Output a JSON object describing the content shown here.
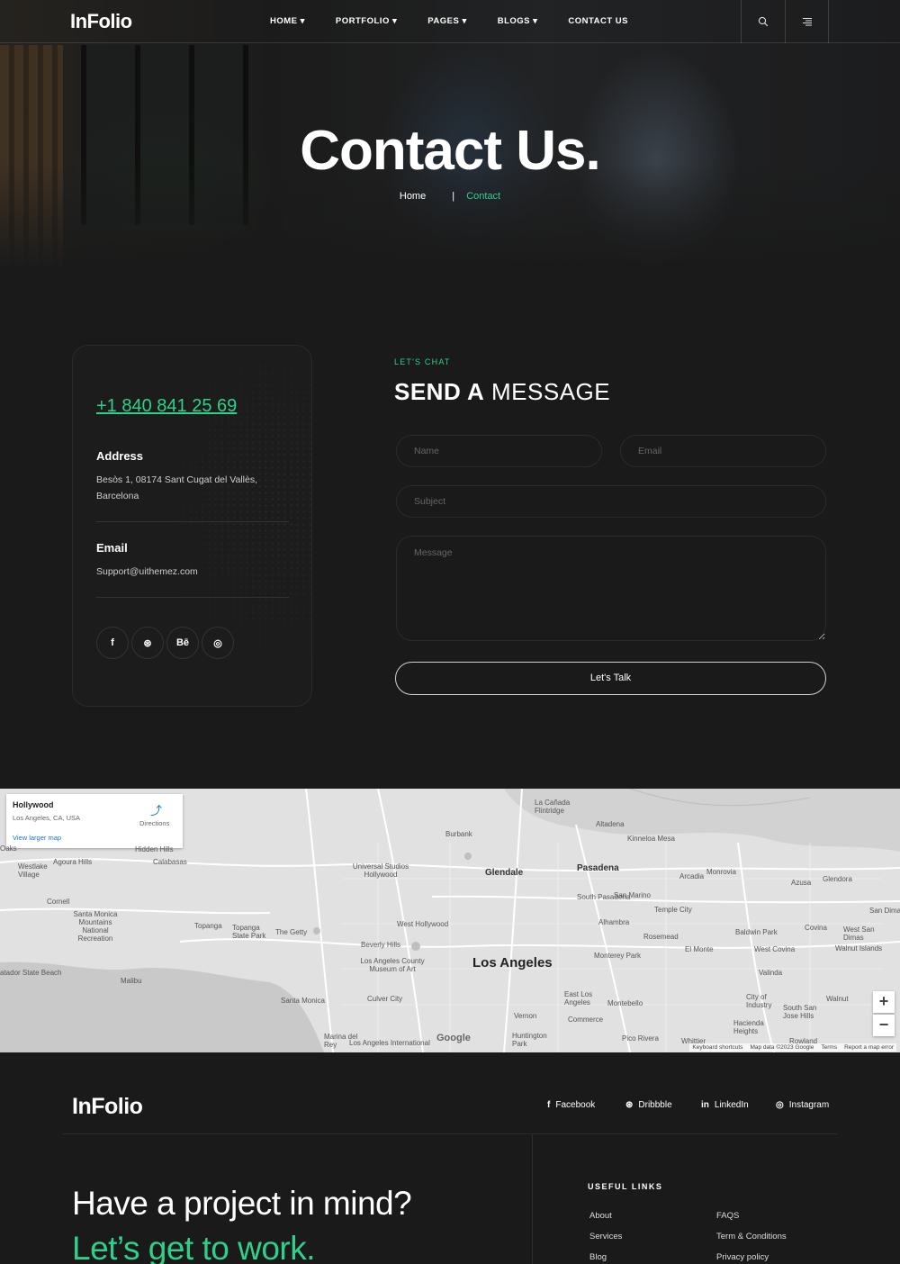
{
  "header": {
    "logo": "InFolio",
    "nav": [
      "HOME ▾",
      "PORTFOLIO ▾",
      "PAGES ▾",
      "BLOGS ▾",
      "CONTACT US"
    ]
  },
  "hero": {
    "title": "Contact Us.",
    "breadcrumb": {
      "home": "Home",
      "separator": "|",
      "current": "Contact"
    }
  },
  "contact": {
    "phone": "+1 840 841 25 69",
    "address_label": "Address",
    "address_line1": "Besòs 1, 08174 Sant Cugat del Vallès,",
    "address_line2": "Barcelona",
    "email_label": "Email",
    "email": "Support@uithemez.com",
    "socials": [
      {
        "icon": "facebook-icon",
        "glyph": "f"
      },
      {
        "icon": "dribbble-icon",
        "glyph": "⊛"
      },
      {
        "icon": "behance-icon",
        "glyph": "Bē"
      },
      {
        "icon": "instagram-icon",
        "glyph": "◎"
      }
    ]
  },
  "form": {
    "eyebrow": "LET'S CHAT",
    "title_bold": "SEND A",
    "title_light": "MESSAGE",
    "name_placeholder": "Name",
    "email_placeholder": "Email",
    "subject_placeholder": "Subject",
    "message_placeholder": "Message",
    "submit_label": "Let's Talk"
  },
  "map": {
    "card_title": "Hollywood",
    "card_subtitle": "Los Angeles, CA, USA",
    "card_link": "View larger map",
    "directions": "Directions",
    "labels": {
      "los_angeles": "Los Angeles",
      "glendale": "Glendale",
      "pasadena": "Pasadena",
      "burbank": "Burbank",
      "santa_monica": "Santa Monica",
      "beverly_hills": "Beverly Hills",
      "west_hollywood": "West Hollywood",
      "culver_city": "Culver City",
      "malibu": "Malibu",
      "topanga": "Topanga",
      "calabasas": "Calabasas",
      "altadena": "Altadena",
      "arcadia": "Arcadia",
      "monrovia": "Monrovia",
      "azusa": "Azusa",
      "glendora": "Glendora",
      "san_marino": "San Marino",
      "south_pasadena": "South Pasadena",
      "alhambra": "Alhambra",
      "temple_city": "Temple City",
      "rosemead": "Rosemead",
      "el_monte": "El Monte",
      "west_covina": "West Covina",
      "covina": "Covina",
      "baldwin_park": "Baldwin Park",
      "monterey_park": "Monterey Park",
      "montebello": "Montebello",
      "commerce": "Commerce",
      "vernon": "Vernon",
      "pico_rivera": "Pico Rivera",
      "whittier": "Whittier",
      "valinda": "Valinda",
      "walnut": "Walnut",
      "hacienda_heights": "Hacienda Heights",
      "rowland": "Rowland",
      "huntington_park": "Huntington Park",
      "marina_del_rey": "Marina del Rey",
      "la_canada": "La Cañada Flintridge",
      "kinneloa_mesa": "Kinneloa Mesa",
      "hidden_hills": "Hidden Hills",
      "agoura_hills": "Agoura Hills",
      "westlake_village": "Westlake Village",
      "cornell": "Cornell",
      "santa_monica_mountains": "Santa Monica Mountains National Recreation",
      "topanga_state_park": "Topanga State Park",
      "getty": "The Getty",
      "lacma": "Los Angeles County Museum of Art",
      "universal": "Universal Studios Hollywood",
      "east_la": "East Los Angeles",
      "city_of_industry": "City of Industry",
      "south_san_jose_hills": "South San Jose Hills",
      "walnut_islands": "Walnut Islands",
      "west_san_dimas": "West San Dimas",
      "san_dimas": "San Dima",
      "la_intl": "Los Angeles International",
      "state_beach": "atador State Beach",
      "oaks": "Oaks"
    },
    "google": "Google",
    "footer_links": [
      "Keyboard shortcuts",
      "Map data ©2023 Google",
      "Terms",
      "Report a map error"
    ],
    "zoom_in": "+",
    "zoom_out": "−"
  },
  "footer": {
    "logo": "InFolio",
    "socials": [
      {
        "icon": "facebook-icon",
        "glyph": "f",
        "label": "Facebook"
      },
      {
        "icon": "dribbble-icon",
        "glyph": "⊛",
        "label": "Dribbble"
      },
      {
        "icon": "linkedin-icon",
        "glyph": "in",
        "label": "LinkedIn"
      },
      {
        "icon": "instagram-icon",
        "glyph": "◎",
        "label": "Instagram"
      }
    ],
    "headline1": "Have a project in mind?",
    "headline2": "Let’s get to work.",
    "links_title": "USEFUL LINKS",
    "links": [
      "About",
      "Services",
      "Blog",
      "FAQS",
      "Term & Conditions",
      "Privacy policy"
    ]
  },
  "colors": {
    "accent": "#2fd08a",
    "background": "#1a1a1a"
  }
}
